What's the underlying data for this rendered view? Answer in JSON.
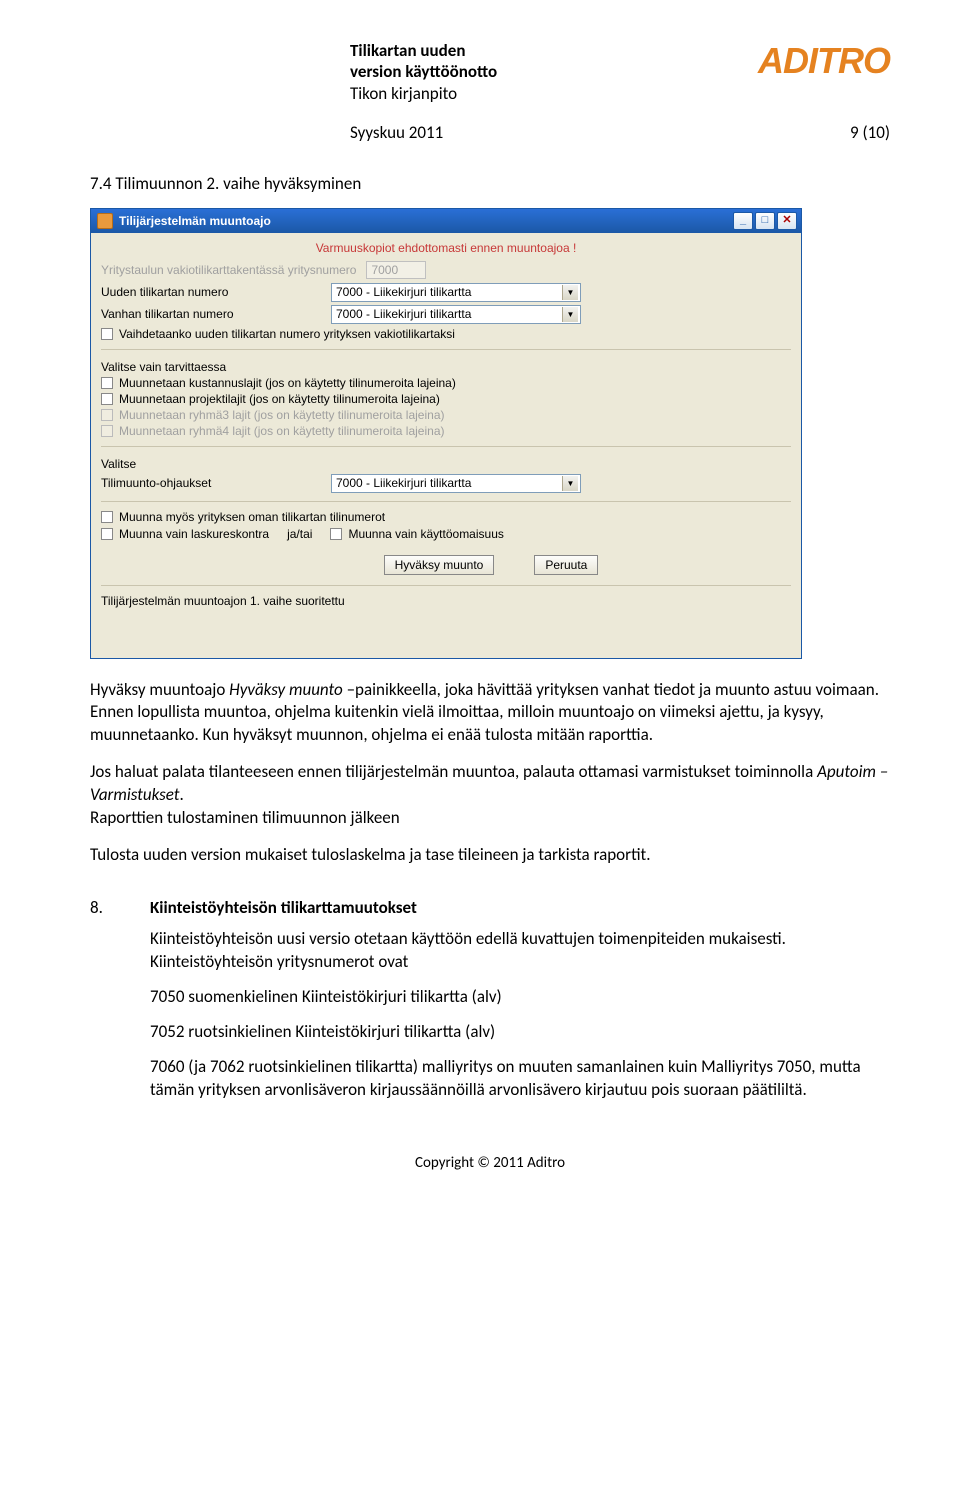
{
  "header": {
    "title_line1": "Tilikartan uuden",
    "title_line2": "version käyttöönotto",
    "subtitle": "Tikon kirjanpito",
    "logo_text": "ADITRO",
    "date": "Syyskuu 2011",
    "page": "9 (10)"
  },
  "section7": {
    "heading": "7.4 Tilimuunnon 2. vaihe hyväksyminen"
  },
  "dialog": {
    "title": "Tilijärjestelmän muuntoajo",
    "backup_warning": "Varmuuskopiot ehdottomasti ennen muuntoajoa !",
    "yritysnumero_label": "Yritystaulun vakiotilikarttakentässä yritysnumero",
    "yritysnumero_value": "7000",
    "uuden_label": "Uuden tilikartan numero",
    "uuden_value": "7000 - Liikekirjuri tilikartta",
    "vanhan_label": "Vanhan tilikartan numero",
    "vanhan_value": "7000 - Liikekirjuri tilikartta",
    "vaihdetaanko": "Vaihdetaanko uuden tilikartan numero yrityksen vakiotilikartaksi",
    "valitse_tarvittaessa": "Valitse vain tarvittaessa",
    "kustannuslajit": "Muunnetaan kustannuslajit (jos on käytetty tilinumeroita lajeina)",
    "projektilajit": "Muunnetaan projektilajit (jos on käytetty tilinumeroita lajeina)",
    "ryhma3": "Muunnetaan ryhmä3 lajit (jos on käytetty tilinumeroita lajeina)",
    "ryhma4": "Muunnetaan ryhmä4 lajit (jos on käytetty tilinumeroita lajeina)",
    "valitse": "Valitse",
    "ohjaukset_label": "Tilimuunto-ohjaukset",
    "ohjaukset_value": "7000 - Liikekirjuri tilikartta",
    "muunna_oman": "Muunna myös yrityksen oman tilikartan tilinumerot",
    "muunna_laskureskontra": "Muunna vain laskureskontra",
    "jatai": "ja/tai",
    "muunna_kayttoomaisuus": "Muunna vain käyttöomaisuus",
    "hyvaksy_btn": "Hyväksy muunto",
    "peruuta_btn": "Peruuta",
    "status": "Tilijärjestelmän muuntoajon 1. vaihe suoritettu"
  },
  "para1_pre": "Hyväksy muuntoajo ",
  "para1_italic": "Hyväksy muunto",
  "para1_post": " –painikkeella, joka hävittää yrityksen vanhat tiedot ja muunto astuu voimaan. Ennen lopullista muuntoa, ohjelma kuitenkin vielä ilmoittaa, milloin muuntoajo on viimeksi ajettu, ja kysyy, muunnetaanko. Kun hyväksyt muunnon, ohjelma ei enää tulosta mitään raporttia.",
  "para2_pre": "Jos haluat palata tilanteeseen ennen tilijärjestelmän muuntoa, palauta ottamasi varmistukset toiminnolla ",
  "para2_italic": "Aputoim – Varmistukset",
  "para2_post": ".",
  "para2_line2": "Raporttien tulostaminen tilimuunnon jälkeen",
  "para3": "Tulosta uuden version mukaiset tuloslaskelma ja tase tileineen ja tarkista raportit.",
  "section8": {
    "num": "8.",
    "title": "Kiinteistöyhteisön tilikarttamuutokset",
    "p1": "Kiinteistöyhteisön uusi versio otetaan käyttöön edellä kuvattujen toimenpiteiden mukaisesti. Kiinteistöyhteisön yritysnumerot ovat",
    "p2": "7050 suomenkielinen Kiinteistökirjuri tilikartta (alv)",
    "p3": "7052 ruotsinkielinen Kiinteistökirjuri tilikartta (alv)",
    "p4": "7060 (ja 7062 ruotsinkielinen tilikartta) malliyritys on muuten samanlainen kuin Malliyritys 7050, mutta tämän yrityksen arvonlisäveron kirjaussäännöillä arvonlisävero kirjautuu pois suoraan päätililtä."
  },
  "footer": "Copyright © 2011 Aditro"
}
